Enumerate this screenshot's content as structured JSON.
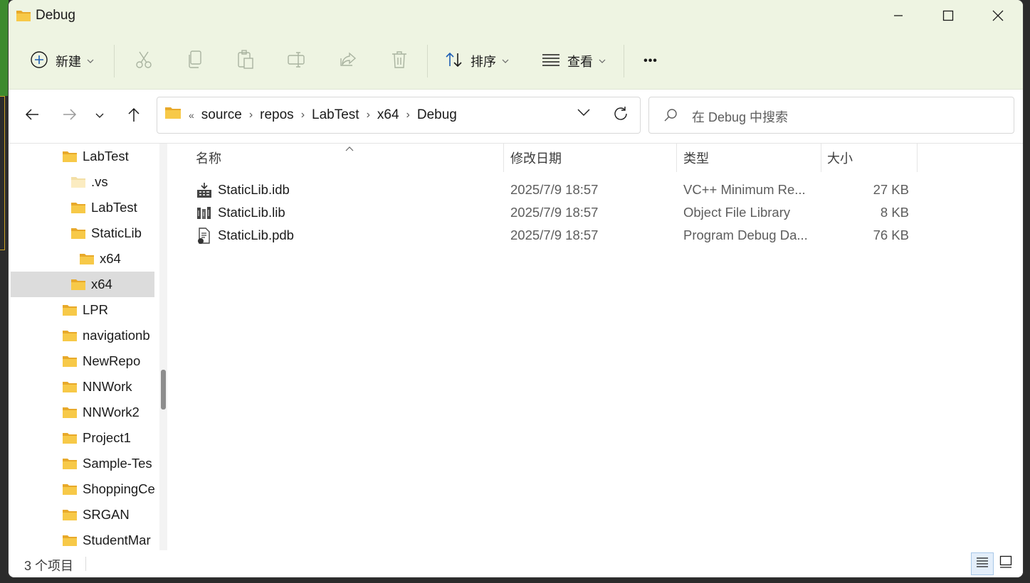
{
  "window": {
    "title": "Debug"
  },
  "toolbar": {
    "new_label": "新建",
    "sort_label": "排序",
    "view_label": "查看",
    "more_label": "•••"
  },
  "address": {
    "overflow": "«",
    "crumbs": [
      "source",
      "repos",
      "LabTest",
      "x64",
      "Debug"
    ]
  },
  "search": {
    "placeholder": "在 Debug 中搜索"
  },
  "sidebar": {
    "items": [
      {
        "label": "LabTest",
        "level": 0
      },
      {
        "label": ".vs",
        "level": 1
      },
      {
        "label": "LabTest",
        "level": 1
      },
      {
        "label": "StaticLib",
        "level": 1
      },
      {
        "label": "x64",
        "level": 2
      },
      {
        "label": "x64",
        "level": 1,
        "selected": true
      },
      {
        "label": "LPR",
        "level": 0
      },
      {
        "label": "navigationb",
        "level": 0
      },
      {
        "label": "NewRepo",
        "level": 0
      },
      {
        "label": "NNWork",
        "level": 0
      },
      {
        "label": "NNWork2",
        "level": 0
      },
      {
        "label": "Project1",
        "level": 0
      },
      {
        "label": "Sample-Tes",
        "level": 0
      },
      {
        "label": "ShoppingCe",
        "level": 0
      },
      {
        "label": "SRGAN",
        "level": 0
      },
      {
        "label": "StudentMar",
        "level": 0
      }
    ]
  },
  "columns": {
    "name": "名称",
    "date": "修改日期",
    "type": "类型",
    "size": "大小"
  },
  "files": [
    {
      "name": "StaticLib.idb",
      "date": "2025/7/9 18:57",
      "type": "VC++ Minimum Re...",
      "size": "27 KB",
      "icon": "idb-file-icon"
    },
    {
      "name": "StaticLib.lib",
      "date": "2025/7/9 18:57",
      "type": "Object File Library",
      "size": "8 KB",
      "icon": "lib-file-icon"
    },
    {
      "name": "StaticLib.pdb",
      "date": "2025/7/9 18:57",
      "type": "Program Debug Da...",
      "size": "76 KB",
      "icon": "pdb-file-icon"
    }
  ],
  "status": {
    "item_count": "3 个项目"
  },
  "colors": {
    "chrome": "#eef4e2",
    "folder": "#f7c948",
    "selected": "#dcdcdc"
  }
}
